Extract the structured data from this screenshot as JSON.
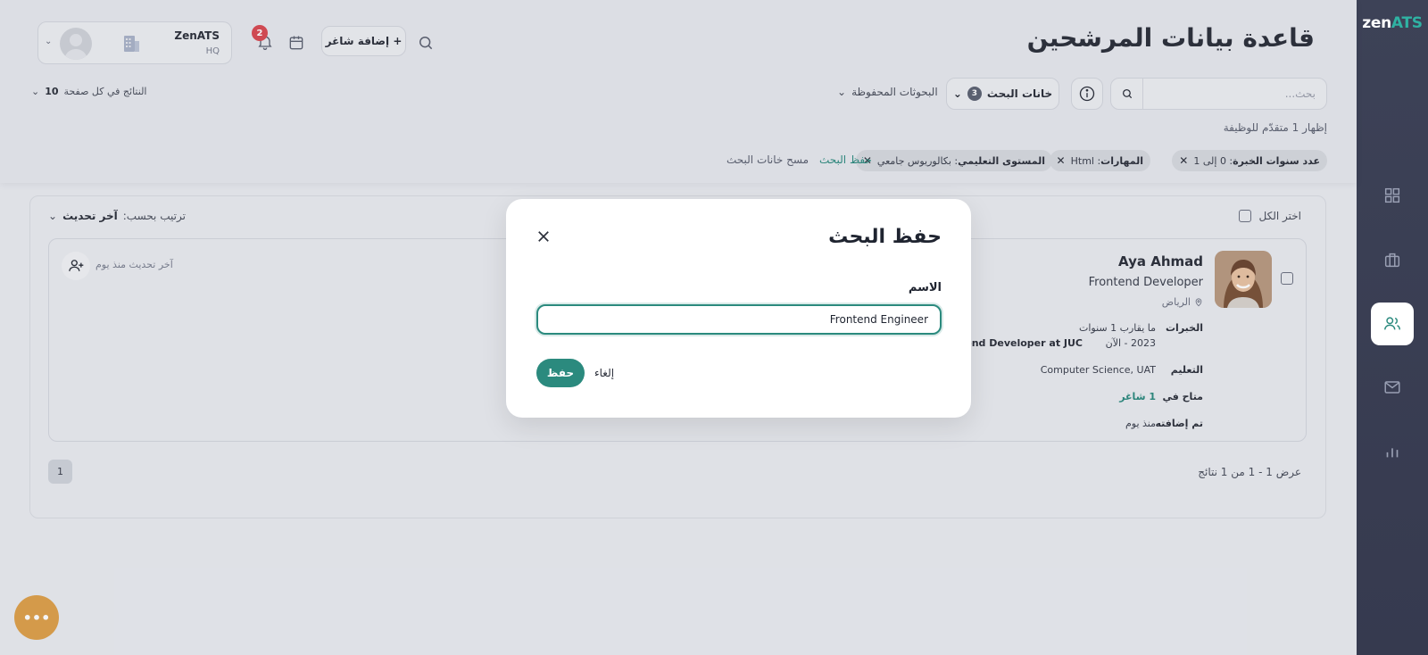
{
  "app": {
    "logo_main": "zen",
    "logo_accent": "ATS"
  },
  "header": {
    "title": "قاعدة بيانات المرشحين",
    "user_name": "ZenATS",
    "user_sub": "HQ",
    "notification_count": "2",
    "add_job_label": "+ إضافة شاغر"
  },
  "toolbar": {
    "search_placeholder": "بحث...",
    "filters_label": "خانات البحث",
    "filters_count": "3",
    "saved_searches_label": "البحوثات المحفوظة",
    "per_page_label": "النتائج في كل صفحة",
    "per_page_value": "10",
    "showing_text": "إظهار 1 متقدّم للوظيفة"
  },
  "filter_chips": [
    {
      "key": "عدد سنوات الخبرة",
      "value": ": 0 إلى 1"
    },
    {
      "key": "المهارات",
      "value": ": Html"
    },
    {
      "key": "المستوى التعليمي",
      "value": ": بكالوريوس جامعي"
    }
  ],
  "filter_actions": {
    "save_search": "حفظ البحث",
    "clear_filters": "مسح خانات البحث"
  },
  "results": {
    "select_all": "اختر الكل",
    "sort_label": "ترتيب بحسب:",
    "sort_value": "آخر تحديث",
    "pagination_current": "1",
    "count_text": "عرض 1 - 1 من 1 نتائج"
  },
  "candidate": {
    "name": "Aya Ahmad",
    "title": "Frontend Developer",
    "location": "الرياض",
    "last_update": "آخر تحديث منذ يوم",
    "experience_label": "الخبرات",
    "experience_duration": "ما يقارب 1 سنوات",
    "experience_dates": "2023 - الآن",
    "experience_role": "Frontend Developer at JUC",
    "education_label": "التعليم",
    "education_value": "Computer Science, UAT",
    "available_label": "متاح في",
    "available_value": "1 شاغر",
    "added_label": "تم إضافته",
    "added_value": "منذ يوم"
  },
  "modal": {
    "title": "حفظ البحث",
    "field_label": "الاسم",
    "name_value": "Frontend Engineer",
    "save_label": "حفظ",
    "cancel_label": "إلغاء"
  },
  "fab_label": "•••",
  "colors": {
    "accent": "#2b8a7e",
    "sidebar": "#3d4257",
    "fab": "#dda04a",
    "badge": "#d84a52"
  },
  "icons": [
    "dashboard-icon",
    "briefcase-icon",
    "users-icon",
    "mail-icon",
    "chart-icon",
    "search-icon",
    "calendar-icon",
    "bell-icon",
    "building-icon",
    "info-icon",
    "close-icon",
    "user-plus-icon",
    "location-pin-icon",
    "chevron-down-icon"
  ]
}
